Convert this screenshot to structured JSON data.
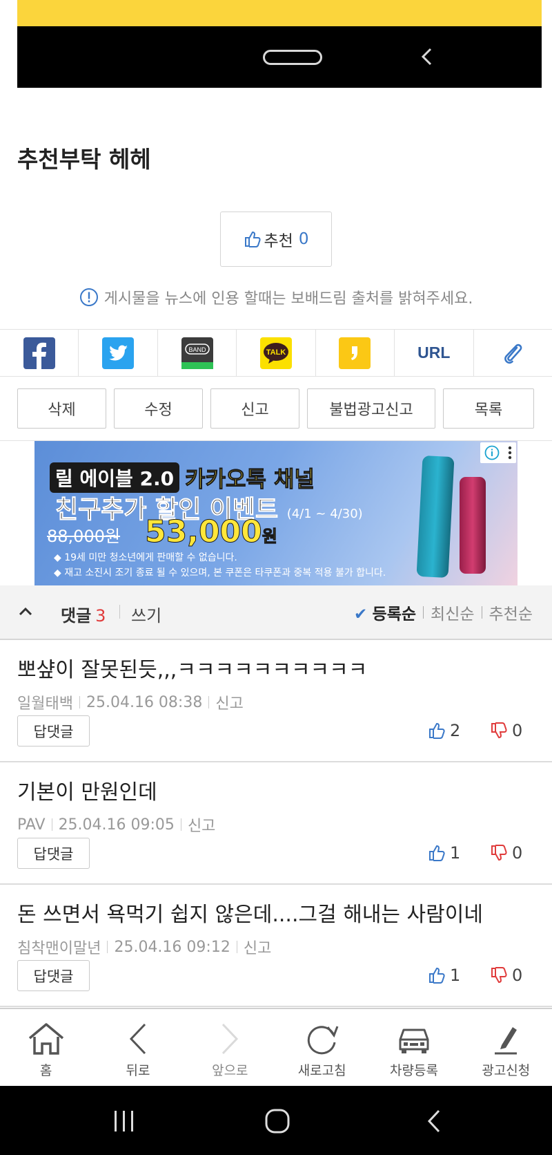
{
  "post": {
    "title": "추천부탁 헤헤",
    "recommend_label": "추천",
    "recommend_count": "0",
    "notice": "게시물을 뉴스에 인용 할때는 보배드림 출처를 밝혀주세요."
  },
  "share": {
    "items": [
      "facebook-icon",
      "twitter-icon",
      "band-icon",
      "kakaotalk-icon",
      "kakaostory-icon",
      "url-link",
      "clip-icon"
    ],
    "band_label": "BAND",
    "talk_label": "TALK",
    "url_label": "URL"
  },
  "actions": {
    "delete": "삭제",
    "edit": "수정",
    "report": "신고",
    "illegal_ad_report": "불법광고신고",
    "list": "목록"
  },
  "ad": {
    "badge": "릴 에이블 2.0",
    "channel": "카카오톡 채널",
    "headline": "친구추가 할인 이벤트",
    "period": "(4/1 ~ 4/30)",
    "old_price": "88,000원",
    "new_price": "53,000",
    "new_price_unit": "원",
    "note1": "◆ 19세 미만 청소년에게 판매할 수 없습니다.",
    "note2": "◆ 재고 소진시 조기 종료 될 수 있으며, 본 쿠폰은 타쿠폰과 중복 적용 불가 합니다."
  },
  "comments_header": {
    "label": "댓글",
    "count": "3",
    "write": "쓰기",
    "sort_registered": "등록순",
    "sort_newest": "최신순",
    "sort_recommended": "추천순"
  },
  "comments": [
    {
      "text": "뽀샾이 잘못된듯,,,ㅋㅋㅋㅋㅋㅋㅋㅋㅋㅋ",
      "author": "일월태백",
      "date": "25.04.16  08:38",
      "report": "신고",
      "reply": "답댓글",
      "up": "2",
      "down": "0"
    },
    {
      "text": "기본이 만원인데",
      "author": "PAV",
      "date": "25.04.16  09:05",
      "report": "신고",
      "reply": "답댓글",
      "up": "1",
      "down": "0"
    },
    {
      "text": "돈 쓰면서 욕먹기 쉽지 않은데....그걸 해내는 사람이네",
      "author": "침착맨이말년",
      "date": "25.04.16  09:12",
      "report": "신고",
      "reply": "답댓글",
      "up": "1",
      "down": "0"
    }
  ],
  "bottom_nav": {
    "home": "홈",
    "back": "뒤로",
    "forward": "앞으로",
    "refresh": "새로고침",
    "car_register": "차량등록",
    "ad_request": "광고신청"
  },
  "colors": {
    "accent_blue": "#3a78c8",
    "downvote_red": "#e03b3b",
    "kakao_yellow": "#fbd53c"
  }
}
